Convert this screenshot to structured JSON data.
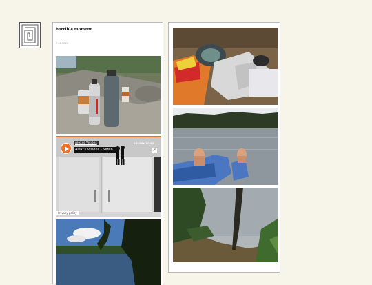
{
  "post": {
    "title": "horrible moment",
    "date": "7-06-2021"
  },
  "embed": {
    "user": "Alexi's Visions",
    "track": "Alexi's Visions - Seren...",
    "logo": "SOUNDCLOUD",
    "privacy": "Privacy policy"
  },
  "icons": {
    "avatar": "maze-logo-icon",
    "play": "play-icon",
    "share": "share-icon"
  },
  "colors": {
    "background": "#f7f4e9",
    "soundcloud_orange": "#f26f23"
  }
}
